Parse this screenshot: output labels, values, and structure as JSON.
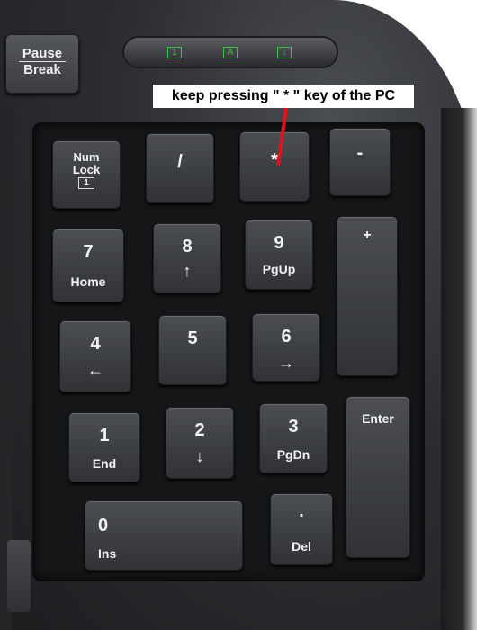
{
  "annotation": {
    "text": "keep pressing \" * \" key of the PC",
    "pointer_color": "#e0151b"
  },
  "top_row": {
    "pause_label_top": "Pause",
    "pause_label_bottom": "Break",
    "leds": [
      "1",
      "A",
      "↓"
    ]
  },
  "keys": {
    "numlock_top": "Num",
    "numlock_mid": "Lock",
    "numlock_icon": "1",
    "slash": "/",
    "asterisk": "*",
    "minus": "-",
    "plus": "+",
    "enter": "Enter",
    "k7": "7",
    "k7_sub": "Home",
    "k8": "8",
    "k8_sub": "↑",
    "k9": "9",
    "k9_sub": "PgUp",
    "k4": "4",
    "k4_sub": "←",
    "k5": "5",
    "k6": "6",
    "k6_sub": "→",
    "k1": "1",
    "k1_sub": "End",
    "k2": "2",
    "k2_sub": "↓",
    "k3": "3",
    "k3_sub": "PgDn",
    "k0": "0",
    "k0_sub": "Ins",
    "dot": ".",
    "dot_sub": "Del"
  }
}
